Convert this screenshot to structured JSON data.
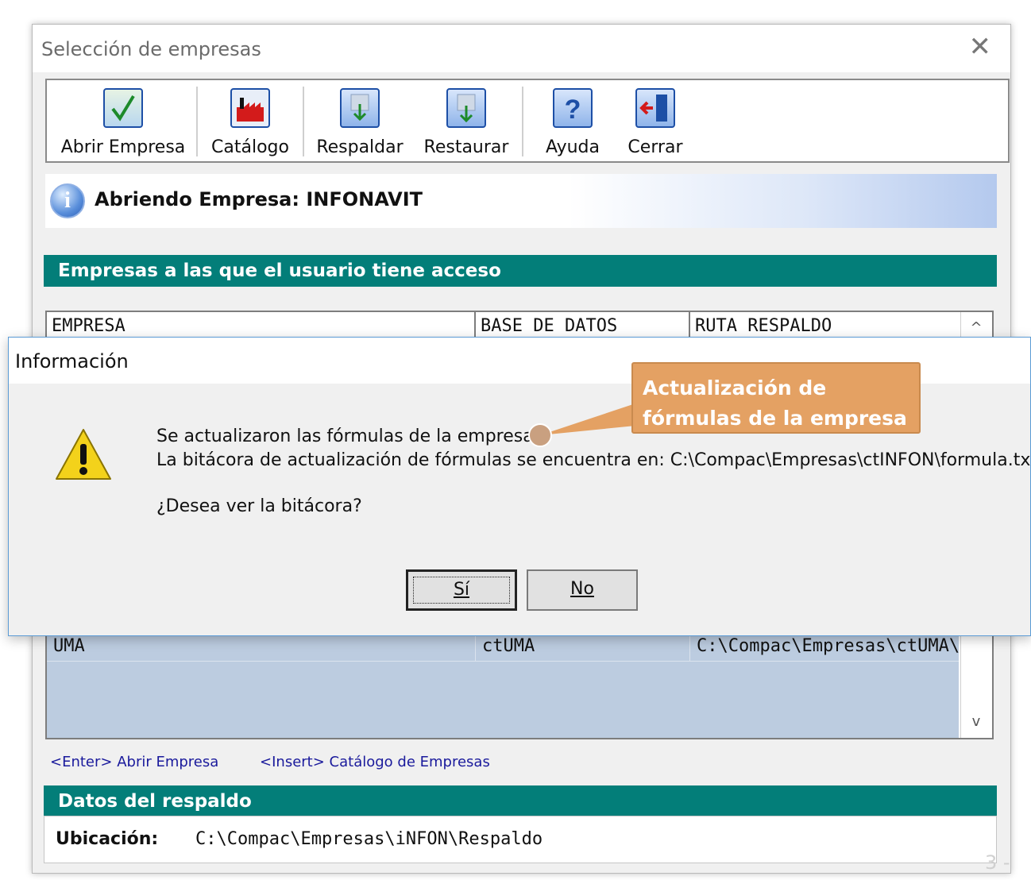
{
  "window": {
    "title": "Selección de empresas",
    "close_glyph": "✕"
  },
  "toolbar": {
    "buttons": [
      {
        "label": "Abrir Empresa",
        "icon": "checkmark-icon"
      },
      {
        "label": "Catálogo",
        "icon": "factory-icon"
      },
      {
        "label": "Respaldar",
        "icon": "backup-icon"
      },
      {
        "label": "Restaurar",
        "icon": "restore-icon"
      },
      {
        "label": "Ayuda",
        "icon": "question-icon"
      },
      {
        "label": "Cerrar",
        "icon": "exit-door-icon"
      }
    ]
  },
  "info_bar": {
    "icon_glyph": "i",
    "text": "Abriendo Empresa: INFONAVIT"
  },
  "companies_section": {
    "title": "Empresas a las que el usuario tiene acceso",
    "columns": [
      "EMPRESA",
      "BASE DE DATOS",
      "RUTA RESPALDO"
    ],
    "rows": [
      {
        "empresa": "UMA",
        "base": "ctUMA",
        "ruta": "C:\\Compac\\Empresas\\ctUMA\\"
      }
    ],
    "scroll_up_glyph": "^",
    "scroll_down_glyph": "v"
  },
  "shortcuts": {
    "open": "<Enter> Abrir Empresa",
    "catalog": "<Insert> Catálogo de Empresas"
  },
  "backup_section": {
    "title": "Datos del respaldo",
    "location_label": "Ubicación:",
    "location_value": "C:\\Compac\\Empresas\\iNFON\\Respaldo"
  },
  "dialog": {
    "title": "Información",
    "line1": "Se actualizaron las fórmulas de la empresa.",
    "line2": "La bitácora de actualización de fórmulas se encuentra en: C:\\Compac\\Empresas\\ctINFON\\formula.txt",
    "question": "¿Desea ver la bitácora?",
    "yes_label": "Sí",
    "no_label": "No"
  },
  "callout": {
    "line1": "Actualización de",
    "line2": "fórmulas de la empresa",
    "color": "#e4a163"
  },
  "watermark": "3 -",
  "colors": {
    "section_bar": "#037e79",
    "row_selected": "#bccce0",
    "dialog_border": "#5b9bd5"
  }
}
